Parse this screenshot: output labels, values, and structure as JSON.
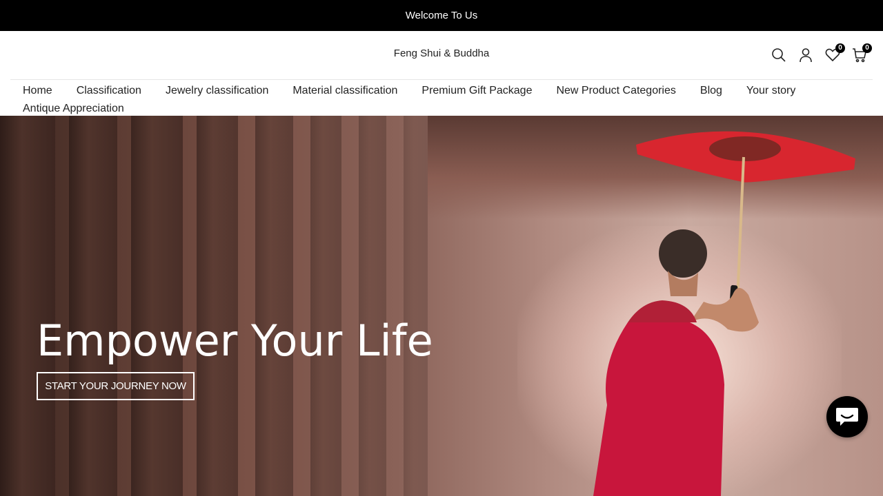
{
  "announcement": {
    "text": "Welcome To Us"
  },
  "header": {
    "logo_text": "Feng Shui & Buddha",
    "wishlist_count": "0",
    "cart_count": "0"
  },
  "nav": {
    "items": [
      {
        "label": "Home"
      },
      {
        "label": "Classification"
      },
      {
        "label": "Jewelry classification"
      },
      {
        "label": "Material classification"
      },
      {
        "label": "Premium Gift Package"
      },
      {
        "label": "New Product Categories"
      },
      {
        "label": "Blog"
      },
      {
        "label": "Your story"
      },
      {
        "label": "Antique Appreciation"
      }
    ]
  },
  "hero": {
    "title": "Empower Your Life",
    "button_label": "START YOUR JOURNEY NOW"
  },
  "icons": {
    "search": "search-icon",
    "account": "user-icon",
    "wishlist": "heart-icon",
    "cart": "cart-icon",
    "chat": "chat-icon"
  },
  "colors": {
    "announcement_bg": "#000000",
    "umbrella": "#d8262f",
    "robe": "#c8163c"
  }
}
